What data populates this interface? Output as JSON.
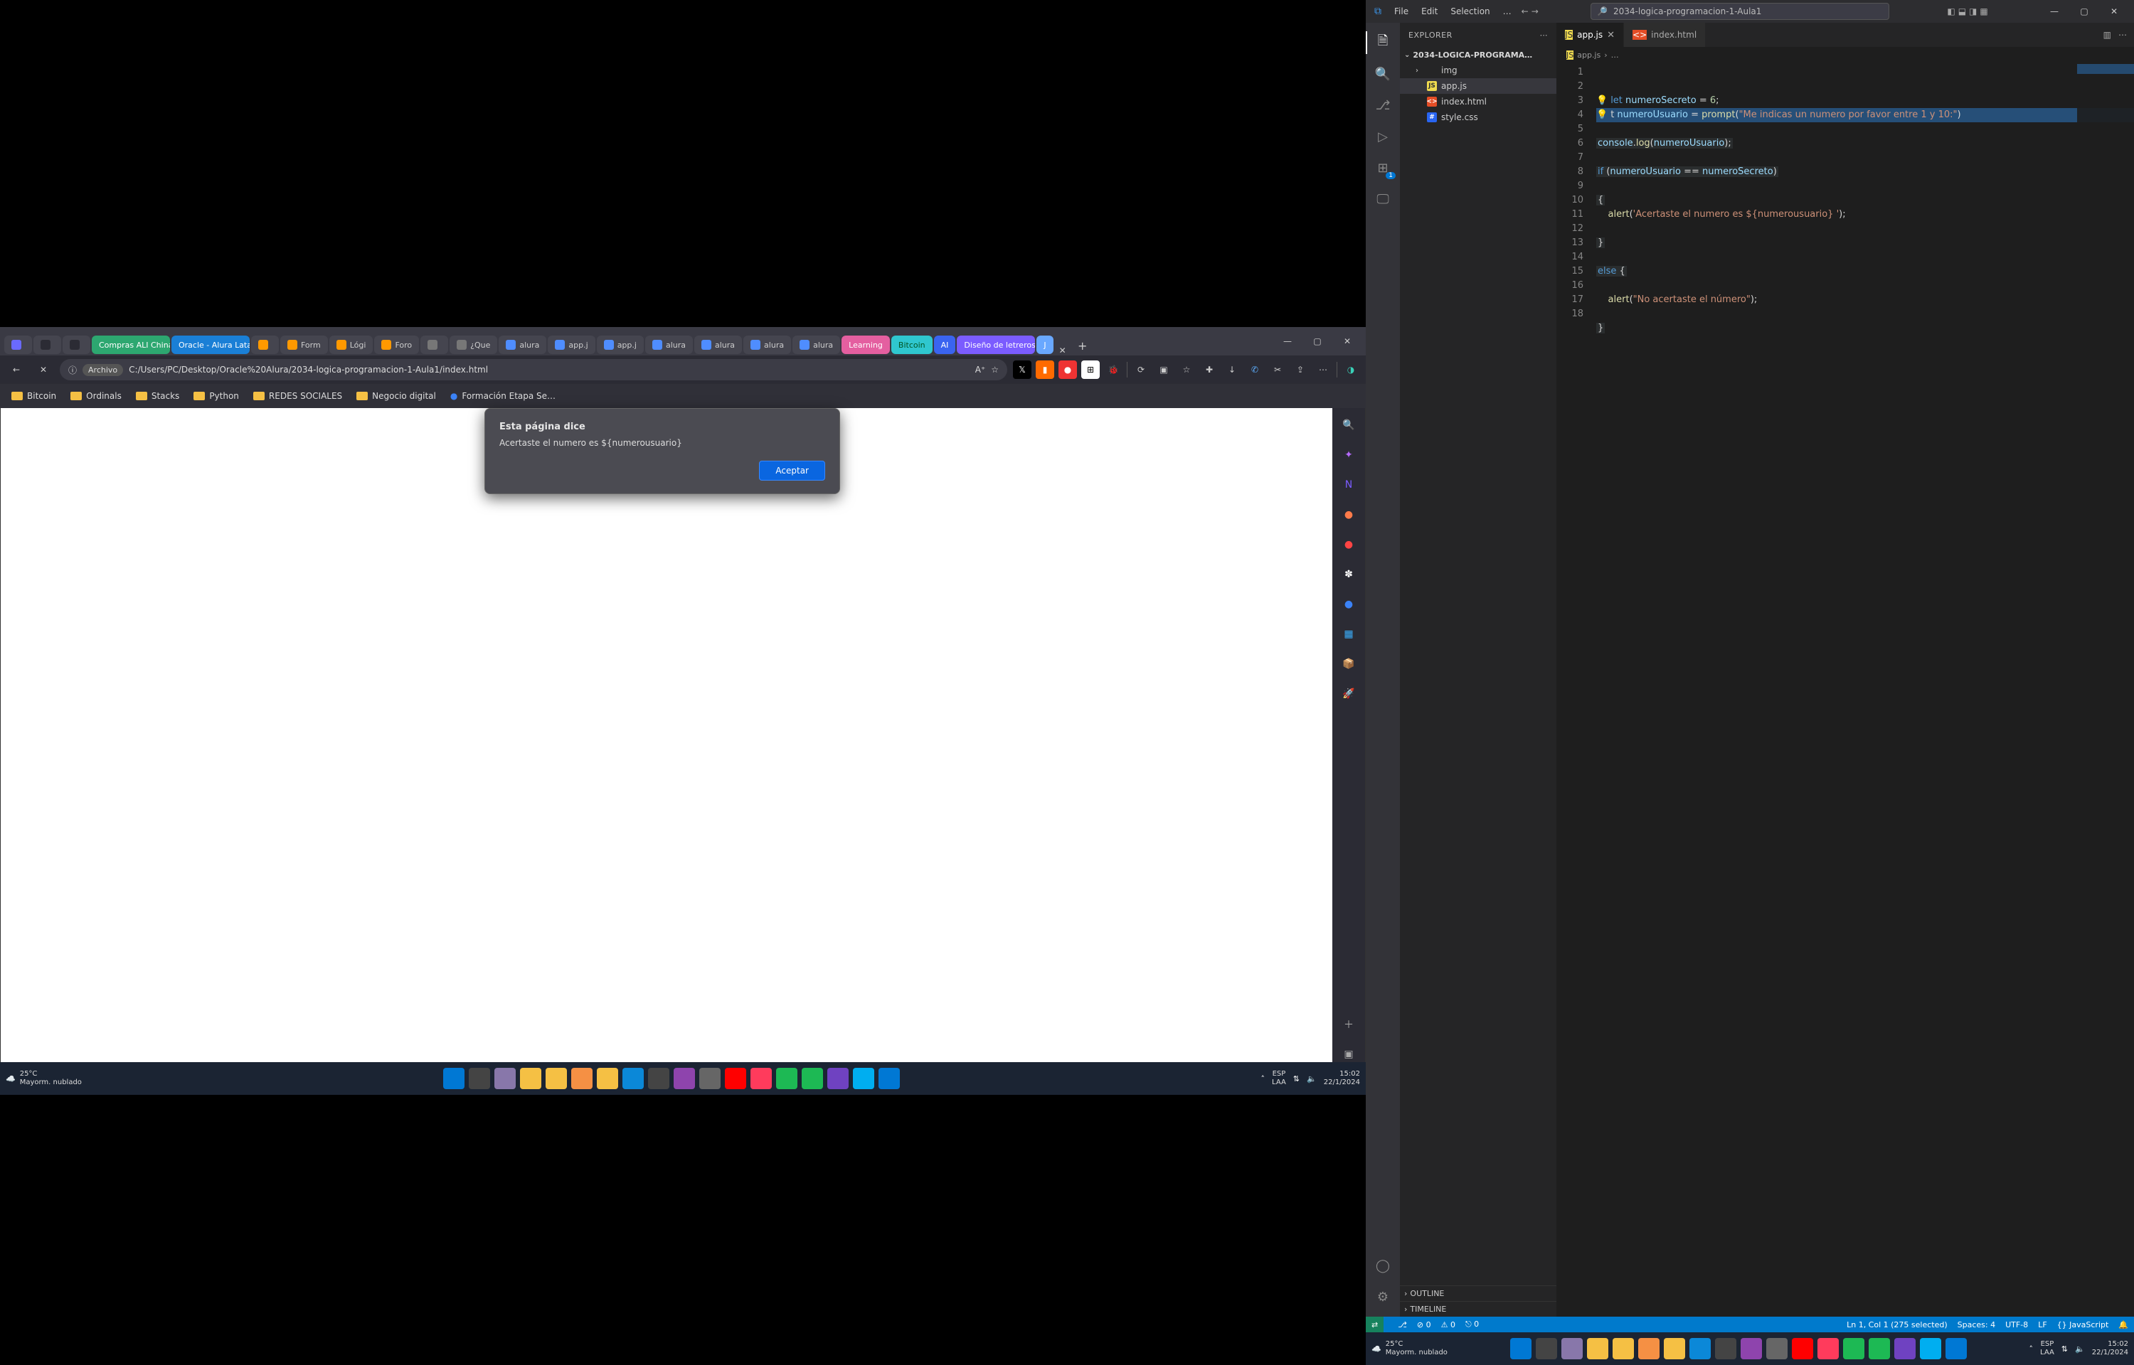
{
  "browser": {
    "tabs": [
      {
        "label": "",
        "style": "plain",
        "fav": "#6a6aff"
      },
      {
        "label": "",
        "style": "plain",
        "fav": "#2b2b34"
      },
      {
        "label": "",
        "style": "plain",
        "fav": "#2b2b34"
      },
      {
        "label": "Compras ALI China",
        "style": "color-green"
      },
      {
        "label": "Oracle - Alura Latam",
        "style": "color-blue"
      },
      {
        "label": "",
        "style": "plain",
        "fav": "#ff9900"
      },
      {
        "label": "Form",
        "style": "plain",
        "fav": "#ff9900"
      },
      {
        "label": "Lógi",
        "style": "plain",
        "fav": "#ff9900"
      },
      {
        "label": "Foro",
        "style": "plain",
        "fav": "#ff9900"
      },
      {
        "label": "",
        "style": "plain",
        "fav": "#777"
      },
      {
        "label": "¿Que",
        "style": "plain",
        "fav": "#777"
      },
      {
        "label": "alura",
        "style": "plain",
        "fav": "#4f8dff"
      },
      {
        "label": "app.j",
        "style": "plain",
        "fav": "#4f8dff"
      },
      {
        "label": "app.j",
        "style": "plain",
        "fav": "#4f8dff"
      },
      {
        "label": "alura",
        "style": "plain",
        "fav": "#4f8dff"
      },
      {
        "label": "alura",
        "style": "plain",
        "fav": "#4f8dff"
      },
      {
        "label": "alura",
        "style": "plain",
        "fav": "#4f8dff"
      },
      {
        "label": "alura",
        "style": "plain",
        "fav": "#4f8dff"
      },
      {
        "label": "Learning",
        "style": "color-pink"
      },
      {
        "label": "Bitcoin",
        "style": "color-cyan"
      },
      {
        "label": "AI",
        "style": "color-dblue"
      },
      {
        "label": "Diseño de letreros",
        "style": "color-purple"
      },
      {
        "label": "J",
        "style": "color-blue2"
      }
    ],
    "address": {
      "scheme": "Archivo",
      "path": "C:/Users/PC/Desktop/Oracle%20Alura/2034-logica-programacion-1-Aula1/index.html"
    },
    "bookmarks": [
      {
        "label": "Bitcoin"
      },
      {
        "label": "Ordinals"
      },
      {
        "label": "Stacks"
      },
      {
        "label": "Python"
      },
      {
        "label": "REDES SOCIALES"
      },
      {
        "label": "Negocio digital"
      },
      {
        "label": "Formación Etapa Se…",
        "fav": true
      }
    ],
    "dialog": {
      "title": "Esta página dice",
      "message": "Acertaste el numero es ${numerousuario}",
      "ok": "Aceptar"
    },
    "rightSidebar": [
      {
        "name": "search-icon",
        "glyph": "🔍",
        "c": ""
      },
      {
        "name": "wand-icon",
        "glyph": "✦",
        "c": "#b76bff"
      },
      {
        "name": "note-icon",
        "glyph": "N",
        "c": "#7b5cff"
      },
      {
        "name": "orb1-icon",
        "glyph": "●",
        "c": "#ff7b4a"
      },
      {
        "name": "orb2-icon",
        "glyph": "●",
        "c": "#ff4444"
      },
      {
        "name": "bug-icon",
        "glyph": "✽",
        "c": "#fff"
      },
      {
        "name": "orb3-icon",
        "glyph": "●",
        "c": "#3b82f6"
      },
      {
        "name": "cal-icon",
        "glyph": "▦",
        "c": "#3ab0ff"
      },
      {
        "name": "box-icon",
        "glyph": "📦",
        "c": "#f5a623"
      },
      {
        "name": "rocket-icon",
        "glyph": "🚀",
        "c": "#8b4aff"
      }
    ]
  },
  "taskbarLeft": {
    "weather": {
      "temp": "25°C",
      "text": "Mayorm. nublado"
    },
    "apps": [
      "start",
      "task",
      "gear",
      "files",
      "files2",
      "edge",
      "word",
      "pp",
      "xl",
      "ff",
      "chat",
      "yt",
      "sp",
      "sp2",
      "sl",
      "sl2",
      "vscode"
    ],
    "tray": {
      "ime": "ESP",
      "ime2": "LAA",
      "time": "15:02",
      "date": "22/1/2024"
    }
  },
  "vscode": {
    "menu": [
      "File",
      "Edit",
      "Selection",
      "…"
    ],
    "search_placeholder": "2034-logica-programacion-1-Aula1",
    "explorer": {
      "header": "EXPLORER",
      "root": "2034-LOGICA-PROGRAMA…",
      "items": [
        {
          "type": "dir",
          "label": "img"
        },
        {
          "type": "js",
          "label": "app.js",
          "sel": true
        },
        {
          "type": "html",
          "label": "index.html"
        },
        {
          "type": "css",
          "label": "style.css"
        }
      ],
      "outline": "OUTLINE",
      "timeline": "TIMELINE"
    },
    "tabs": [
      {
        "label": "app.js",
        "icon": "js",
        "active": true,
        "close": true
      },
      {
        "label": "index.html",
        "icon": "html",
        "active": false
      }
    ],
    "crumbs": [
      "app.js",
      "…"
    ],
    "code": {
      "lines": [
        {
          "bulb": true,
          "raw": "let numeroSecreto = 6;",
          "t": [
            [
              "kw",
              "let "
            ],
            [
              "var",
              "numeroSecreto"
            ],
            [
              "pun",
              " = "
            ],
            [
              "num",
              "6"
            ],
            [
              "pun",
              ";"
            ]
          ]
        },
        {
          "bulb": true,
          "raw": "t numeroUsuario = prompt(\"Me indicas un numero por favor entre 1 y 10:\")",
          "t": [
            [
              "pun",
              "t "
            ],
            [
              "var",
              "numeroUsuario"
            ],
            [
              "pun",
              " = "
            ],
            [
              "fn",
              "prompt"
            ],
            [
              "pun",
              "("
            ],
            [
              "str",
              "\"Me indicas un numero por favor entre 1 y 10:\""
            ],
            [
              "pun",
              ")"
            ]
          ],
          "hl": true
        },
        {
          "raw": ""
        },
        {
          "raw": "console.log(numeroUsuario);",
          "t": [
            [
              "var",
              "console"
            ],
            [
              "pun",
              "."
            ],
            [
              "fn",
              "log"
            ],
            [
              "pun",
              "("
            ],
            [
              "var",
              "numeroUsuario"
            ],
            [
              "pun",
              ");"
            ]
          ],
          "hlpart": true
        },
        {
          "raw": ""
        },
        {
          "raw": "if (numeroUsuario == numeroSecreto)",
          "t": [
            [
              "kw",
              "if "
            ],
            [
              "pun",
              "("
            ],
            [
              "var",
              "numeroUsuario"
            ],
            [
              "pun",
              " == "
            ],
            [
              "var",
              "numeroSecreto"
            ],
            [
              "pun",
              ")"
            ]
          ],
          "hlpart": true
        },
        {
          "raw": ""
        },
        {
          "raw": "{",
          "t": [
            [
              "pun",
              "{"
            ]
          ],
          "hlpart": true
        },
        {
          "raw": "    alert('Acertaste el numero es ${numerousuario} ');",
          "t": [
            [
              "pun",
              "    "
            ],
            [
              "fn",
              "alert"
            ],
            [
              "pun",
              "("
            ],
            [
              "str",
              "'Acertaste el numero es ${numerousuario} '"
            ],
            [
              "pun",
              ");"
            ]
          ]
        },
        {
          "raw": ""
        },
        {
          "raw": "}",
          "t": [
            [
              "pun",
              "}"
            ]
          ],
          "hlpart": true
        },
        {
          "raw": ""
        },
        {
          "raw": "else {",
          "t": [
            [
              "kw",
              "else "
            ],
            [
              "pun",
              "{"
            ]
          ],
          "hlpart": true
        },
        {
          "raw": ""
        },
        {
          "raw": "    alert(\"No acertaste el número\");",
          "t": [
            [
              "pun",
              "    "
            ],
            [
              "fn",
              "alert"
            ],
            [
              "pun",
              "("
            ],
            [
              "str",
              "\"No acertaste el número\""
            ],
            [
              "pun",
              ");"
            ]
          ]
        },
        {
          "raw": ""
        },
        {
          "raw": "}",
          "t": [
            [
              "pun",
              "}"
            ]
          ],
          "hlpart": true
        },
        {
          "raw": ""
        }
      ]
    },
    "status": {
      "remote": "⇄",
      "branch": "⎇",
      "errors": "⊘ 0",
      "warnings": "⚠ 0",
      "port": "⎋ 0",
      "cursor": "Ln 1, Col 1 (275 selected)",
      "spaces": "Spaces: 4",
      "encoding": "UTF-8",
      "eol": "LF",
      "lang": "{} JavaScript",
      "bell": "🔔"
    }
  },
  "taskbarRight": {
    "weather": {
      "temp": "25°C",
      "text": "Mayorm. nublado"
    },
    "tray": {
      "ime": "ESP",
      "ime2": "LAA",
      "time": "15:02",
      "date": "22/1/2024"
    }
  }
}
